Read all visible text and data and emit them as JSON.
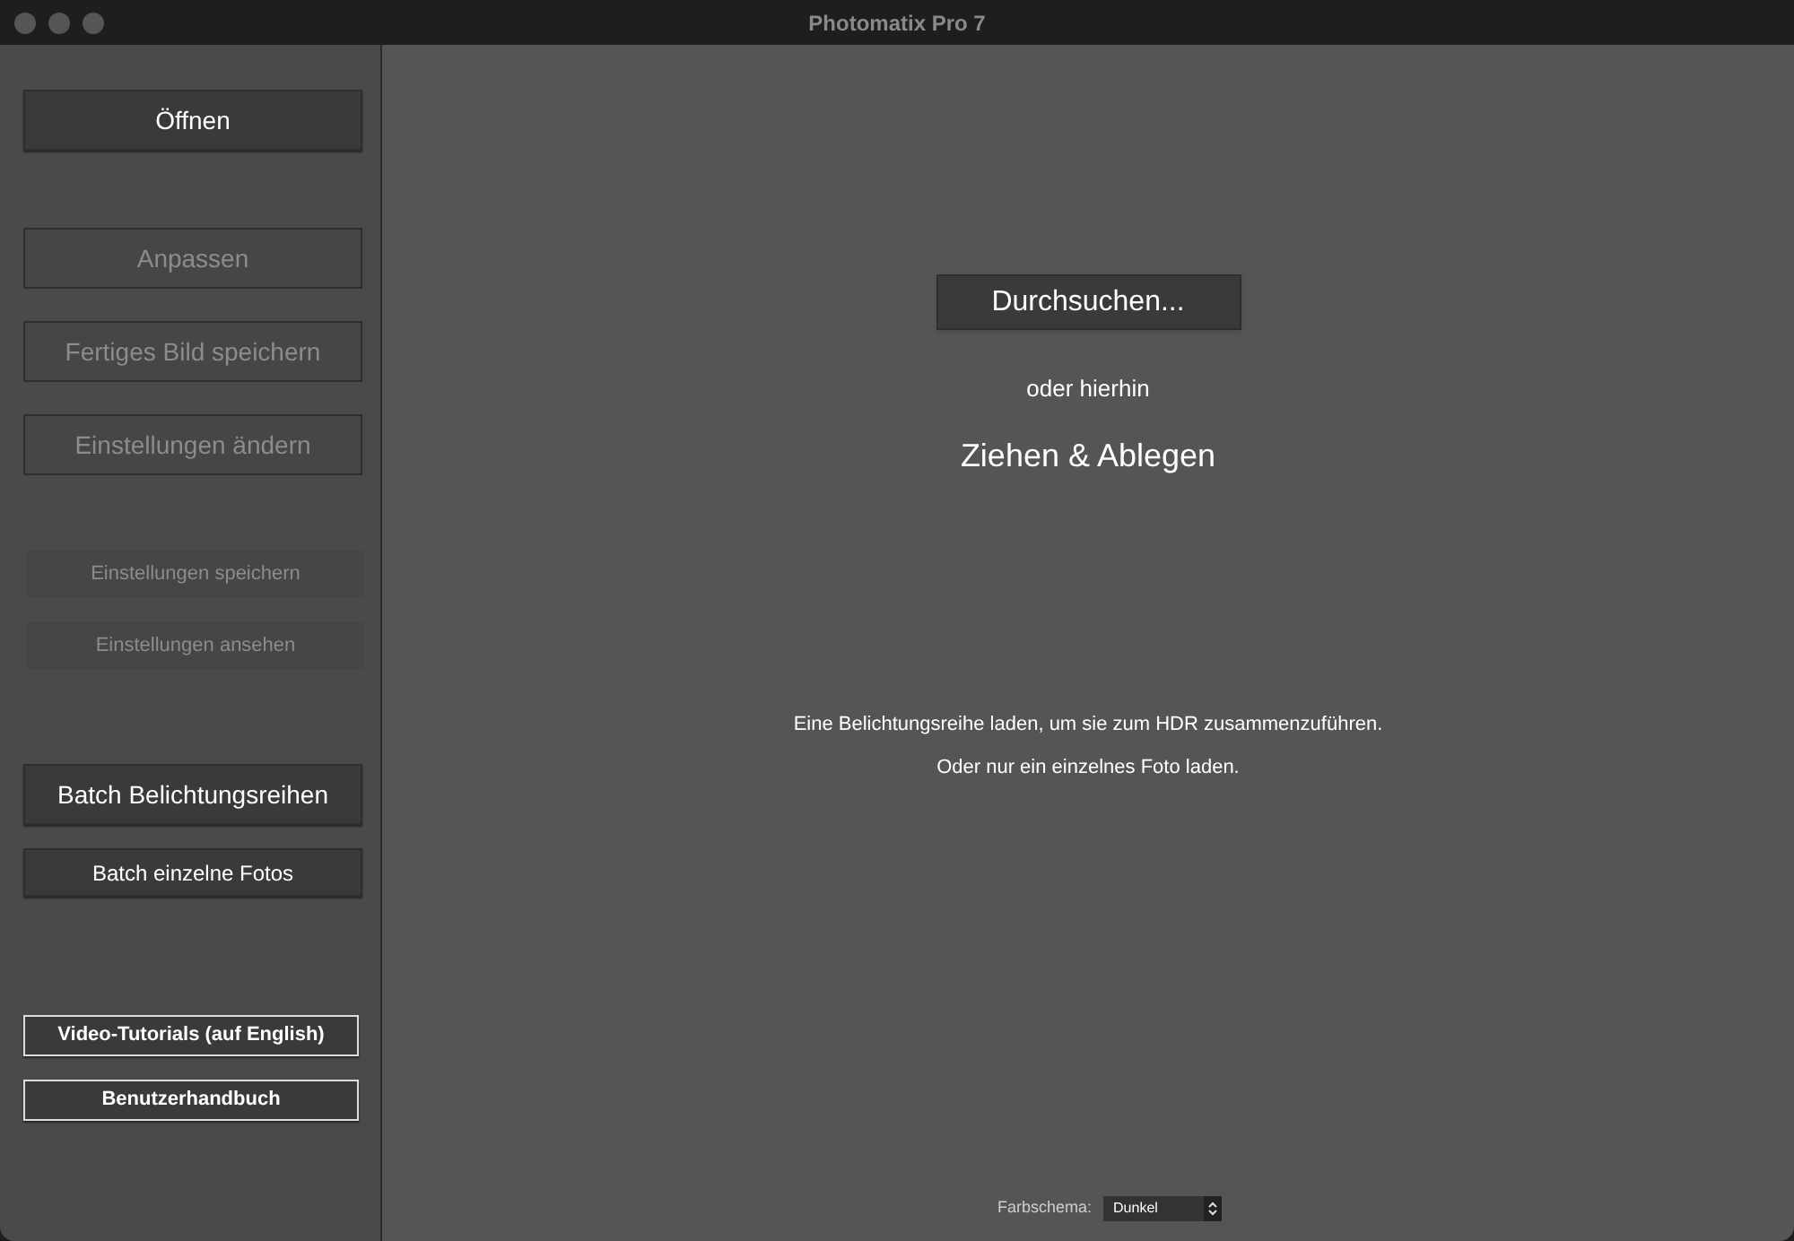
{
  "window": {
    "title": "Photomatix Pro 7"
  },
  "sidebar": {
    "groups": [
      {
        "buttons": [
          {
            "label": "Öffnen",
            "kind": "large",
            "disabled": false
          }
        ]
      },
      {
        "buttons": [
          {
            "label": "Anpassen",
            "kind": "large",
            "disabled": true
          },
          {
            "label": "Fertiges Bild speichern",
            "kind": "large",
            "disabled": true
          },
          {
            "label": "Einstellungen ändern",
            "kind": "large",
            "disabled": true
          }
        ]
      },
      {
        "buttons": [
          {
            "label": "Einstellungen speichern",
            "kind": "small",
            "disabled": true
          },
          {
            "label": "Einstellungen ansehen",
            "kind": "small",
            "disabled": true
          }
        ]
      },
      {
        "buttons": [
          {
            "label": "Batch Belichtungsreihen",
            "kind": "large",
            "disabled": false
          },
          {
            "label": "Batch einzelne Fotos",
            "kind": "medium",
            "disabled": false
          }
        ]
      },
      {
        "buttons": [
          {
            "label": "Video-Tutorials (auf English)",
            "kind": "outline",
            "disabled": false
          },
          {
            "label": "Benutzerhandbuch",
            "kind": "outline",
            "disabled": false
          }
        ]
      }
    ]
  },
  "main": {
    "browse_button": "Durchsuchen...",
    "or_text": "oder hierhin",
    "drop_text": "Ziehen & Ablegen",
    "info_lines": [
      "Eine Belichtungsreihe laden, um sie zum HDR zusammenzuführen.",
      "Oder nur ein einzelnes Foto laden."
    ],
    "color_scheme": {
      "label": "Farbschema:",
      "value": "Dunkel"
    }
  }
}
